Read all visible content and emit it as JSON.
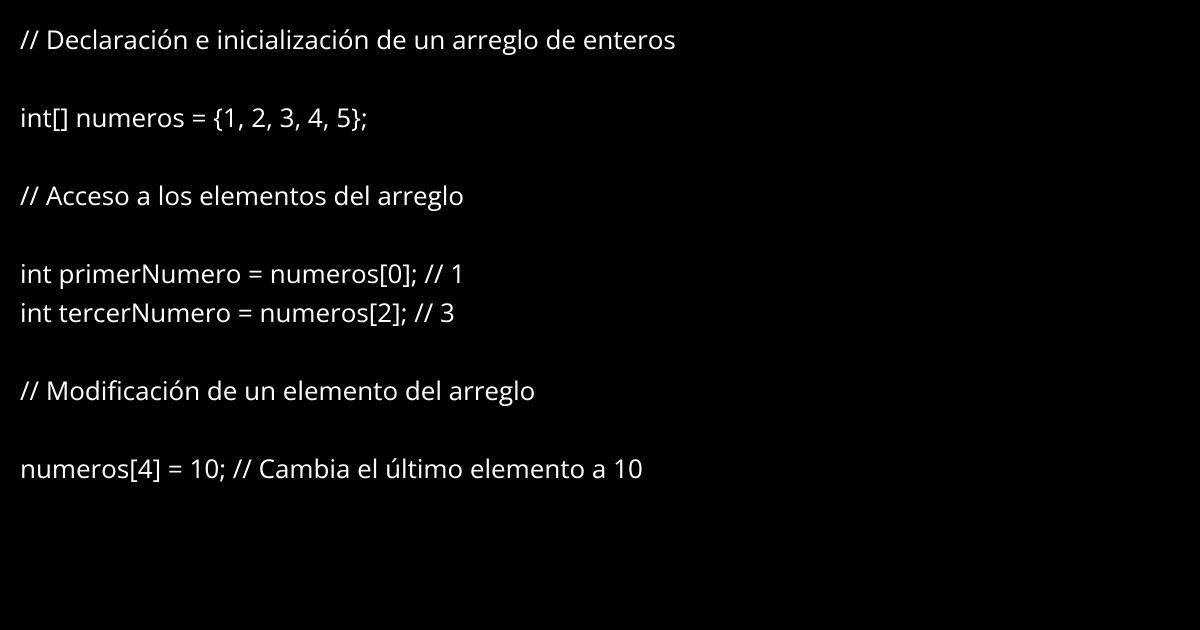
{
  "code": {
    "line1": "// Declaración e inicialización de un arreglo de enteros",
    "line2": "int[] numeros = {1, 2, 3, 4, 5};",
    "line3": "// Acceso a los elementos del arreglo",
    "line4": "int primerNumero = numeros[0]; // 1",
    "line5": "int tercerNumero = numeros[2]; // 3",
    "line6": "// Modificación de un elemento del arreglo",
    "line7": "numeros[4] = 10; // Cambia el último elemento a 10"
  }
}
